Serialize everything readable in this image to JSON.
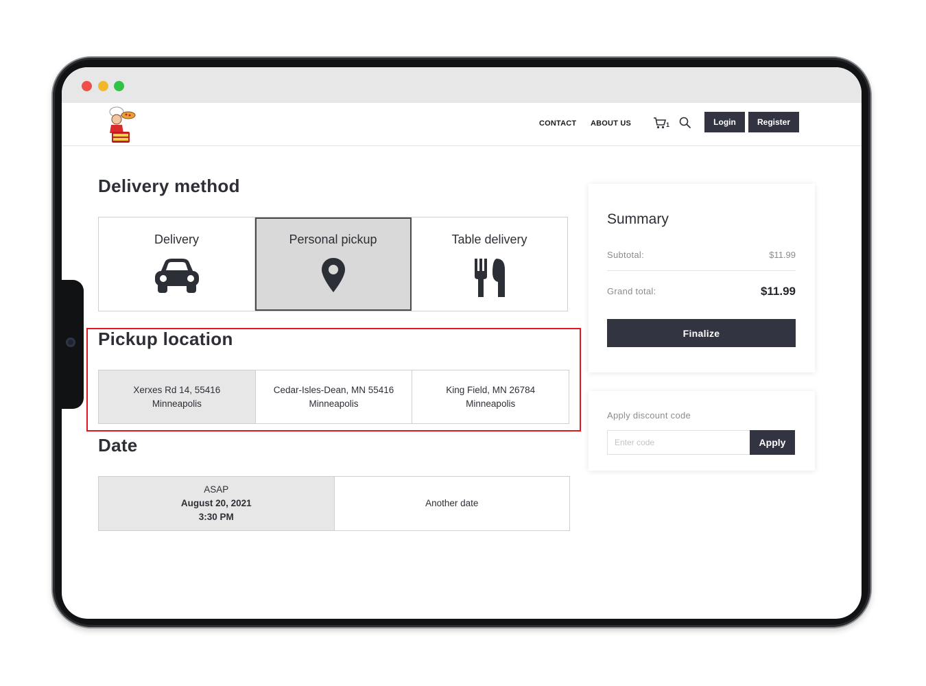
{
  "nav": {
    "contact": "CONTACT",
    "about": "ABOUT US",
    "cart_count": "1",
    "login": "Login",
    "register": "Register"
  },
  "delivery_method": {
    "title": "Delivery method",
    "options": [
      {
        "label": "Delivery",
        "icon": "car-icon",
        "selected": false
      },
      {
        "label": "Personal pickup",
        "icon": "map-pin-icon",
        "selected": true
      },
      {
        "label": "Table delivery",
        "icon": "fork-knife-icon",
        "selected": false
      }
    ]
  },
  "pickup_location": {
    "title": "Pickup location",
    "options": [
      {
        "label": "Xerxes Rd 14, 55416 Minneapolis",
        "selected": true
      },
      {
        "label": "Cedar-Isles-Dean, MN 55416 Minneapolis",
        "selected": false
      },
      {
        "label": "King Field, MN 26784 Minneapolis",
        "selected": false
      }
    ]
  },
  "date": {
    "title": "Date",
    "asap": {
      "label": "ASAP",
      "date": "August 20, 2021",
      "time": "3:30 PM",
      "selected": true
    },
    "another": "Another date"
  },
  "summary": {
    "title": "Summary",
    "subtotal_label": "Subtotal:",
    "subtotal_value": "$11.99",
    "grand_label": "Grand total:",
    "grand_value": "$11.99",
    "finalize": "Finalize"
  },
  "discount": {
    "label": "Apply discount code",
    "placeholder": "Enter code",
    "apply": "Apply"
  },
  "colors": {
    "accent_dark": "#323441",
    "highlight_red": "#e2161c",
    "selected_bg": "#e7e7e7"
  }
}
